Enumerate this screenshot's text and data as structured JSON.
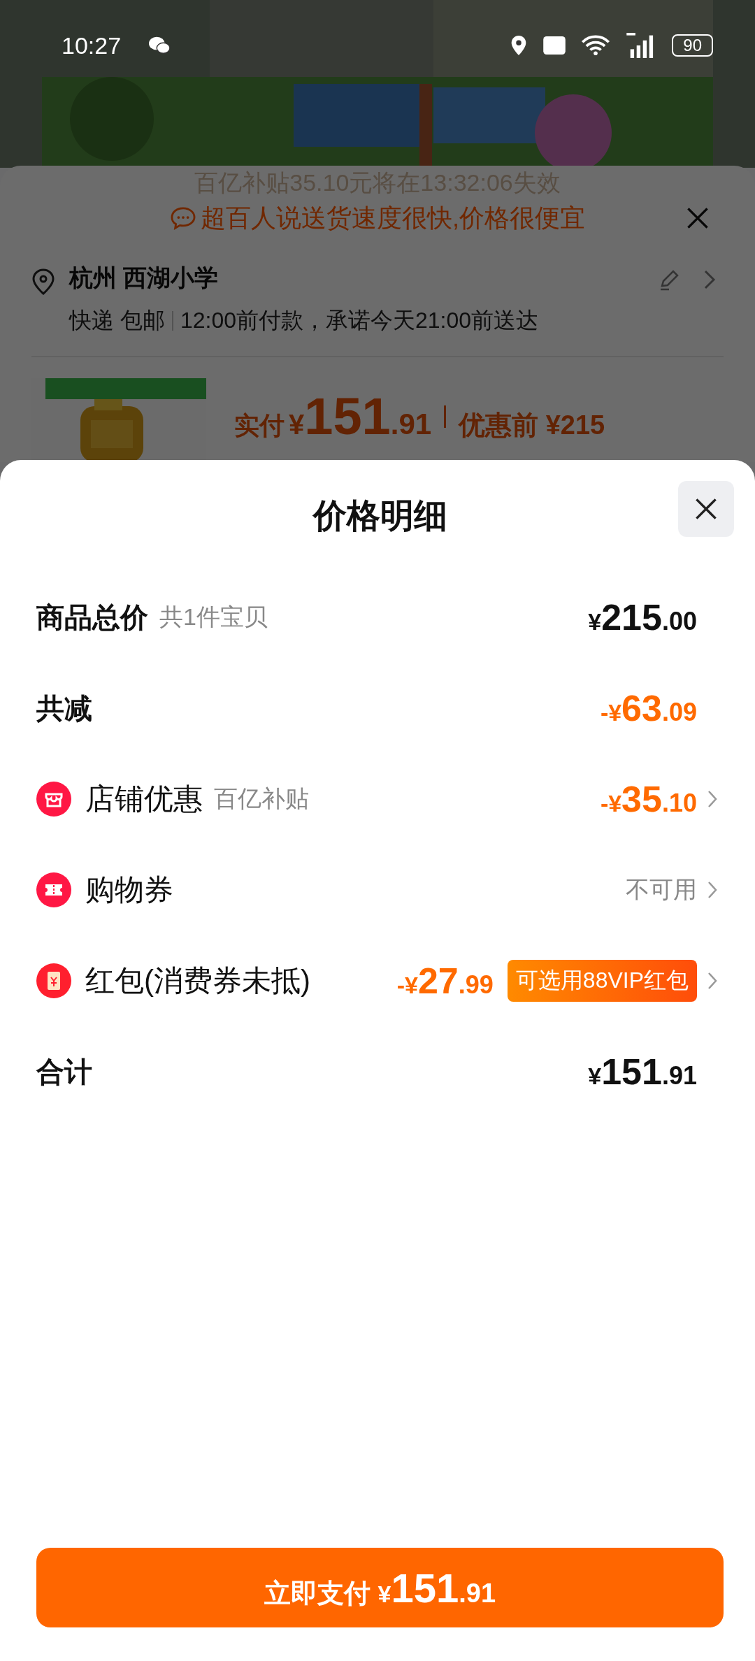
{
  "status_bar": {
    "time": "10:27",
    "battery": "90"
  },
  "background_sheet": {
    "expiry_notice": "百亿补贴35.10元将在13:32:06失效",
    "tip": "超百人说送货速度很快,价格很便宜",
    "address": "杭州 西湖小学",
    "shipping": "快递 包邮",
    "delivery": "12:00前付款，承诺今天21:00前送达",
    "product": {
      "paid_label": "实付",
      "paid": {
        "prefix": "¥",
        "main": "151",
        "cents": ".91"
      },
      "original_label": "优惠前",
      "original": "¥215"
    }
  },
  "sheet": {
    "title": "价格明细",
    "rows": [
      {
        "kind": "total",
        "label": "商品总价",
        "note": "共1件宝贝",
        "amount": {
          "prefix": "¥",
          "main": "215",
          "cents": ".00"
        }
      },
      {
        "kind": "reduction",
        "label": "共减",
        "amount": {
          "prefix": "-¥",
          "main": "63",
          "cents": ".09"
        }
      },
      {
        "kind": "discount",
        "label": "店铺优惠",
        "note": "百亿补贴",
        "amount": {
          "prefix": "-¥",
          "main": "35",
          "cents": ".10"
        }
      },
      {
        "kind": "unavailable",
        "label": "购物券",
        "value": "不可用"
      },
      {
        "kind": "redpacket",
        "label": "红包(消费券未抵)",
        "amount": {
          "prefix": "-¥",
          "main": "27",
          "cents": ".99"
        },
        "badge": "可选用88VIP红包"
      },
      {
        "kind": "sum",
        "label": "合计",
        "amount": {
          "prefix": "¥",
          "main": "151",
          "cents": ".91"
        }
      }
    ],
    "pay_button": {
      "label": "立即支付",
      "amount": {
        "prefix": "¥",
        "main": "151",
        "cents": ".91"
      }
    }
  }
}
